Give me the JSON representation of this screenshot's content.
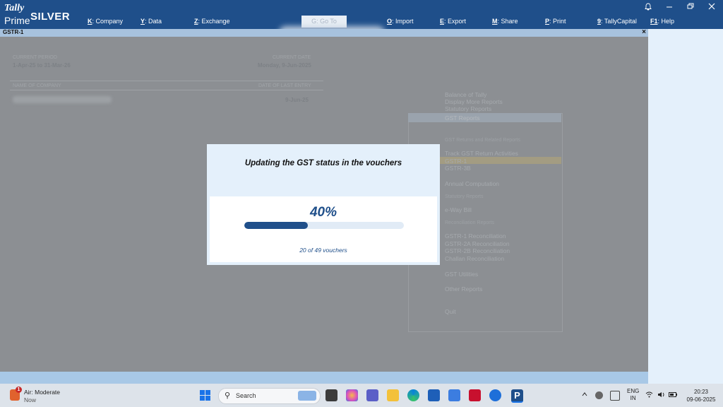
{
  "app": {
    "logo_top": "Tally",
    "logo_bottom": "Prime",
    "edition": "SILVER"
  },
  "menu": [
    {
      "key": "K",
      "label": ": Company"
    },
    {
      "key": "Y",
      "label": ": Data"
    },
    {
      "key": "Z",
      "label": ": Exchange"
    },
    {
      "key": "O",
      "label": ": Import"
    },
    {
      "key": "E",
      "label": ": Export"
    },
    {
      "key": "M",
      "label": ": Share"
    },
    {
      "key": "P",
      "label": ": Print"
    },
    {
      "key": "9",
      "label": ": TallyCapital"
    },
    {
      "key": "F1",
      "label": ": Help"
    }
  ],
  "goto_label": "G: Go To",
  "window_title": "GSTR-1",
  "close_glyph": "×",
  "company_info": {
    "current_period_label": "CURRENT PERIOD",
    "current_period_value": "1-Apr-25 to 31-Mar-26",
    "current_date_label": "CURRENT DATE",
    "current_date_value": "Monday, 9-Jun-2025",
    "company_name_label": "NAME OF COMPANY",
    "last_entry_label": "DATE OF LAST ENTRY",
    "last_entry_value": "9-Jun-25"
  },
  "gst_menu": {
    "top_items": [
      "Balance of Tally",
      "Display More Reports",
      "Statutory Reports"
    ],
    "header": "GST Reports",
    "section1": "GST Returns and Related Reports",
    "items1": [
      "Track GST Return Activities",
      "GSTR-1",
      "GSTR-3B"
    ],
    "item_annual": "Annual Computation",
    "section2": "Statutory Reports",
    "item_eway": "e-Way Bill",
    "section3": "Reconciliation Reports",
    "items3": [
      "GSTR-1 Reconciliation",
      "GSTR-2A Reconciliation",
      "GSTR-2B Reconciliation",
      "Challan Reconciliation"
    ],
    "item_utilities": "GST Utilities",
    "item_other": "Other Reports",
    "item_quit": "Quit"
  },
  "dialog": {
    "title": "Updating the GST status in the vouchers",
    "progress_percent": 40,
    "progress_label": "40%",
    "count_text": "20 of 49 vouchers"
  },
  "taskbar": {
    "weather_title": "Air: Moderate",
    "weather_sub": "Now",
    "weather_badge": "1",
    "search_label": "Search",
    "lang_top": "ENG",
    "lang_bottom": "IN",
    "time": "20:23",
    "date": "09-06-2025"
  },
  "colors": {
    "accent": "#1f4f8a",
    "dialog_bg": "#e4f0fb"
  }
}
